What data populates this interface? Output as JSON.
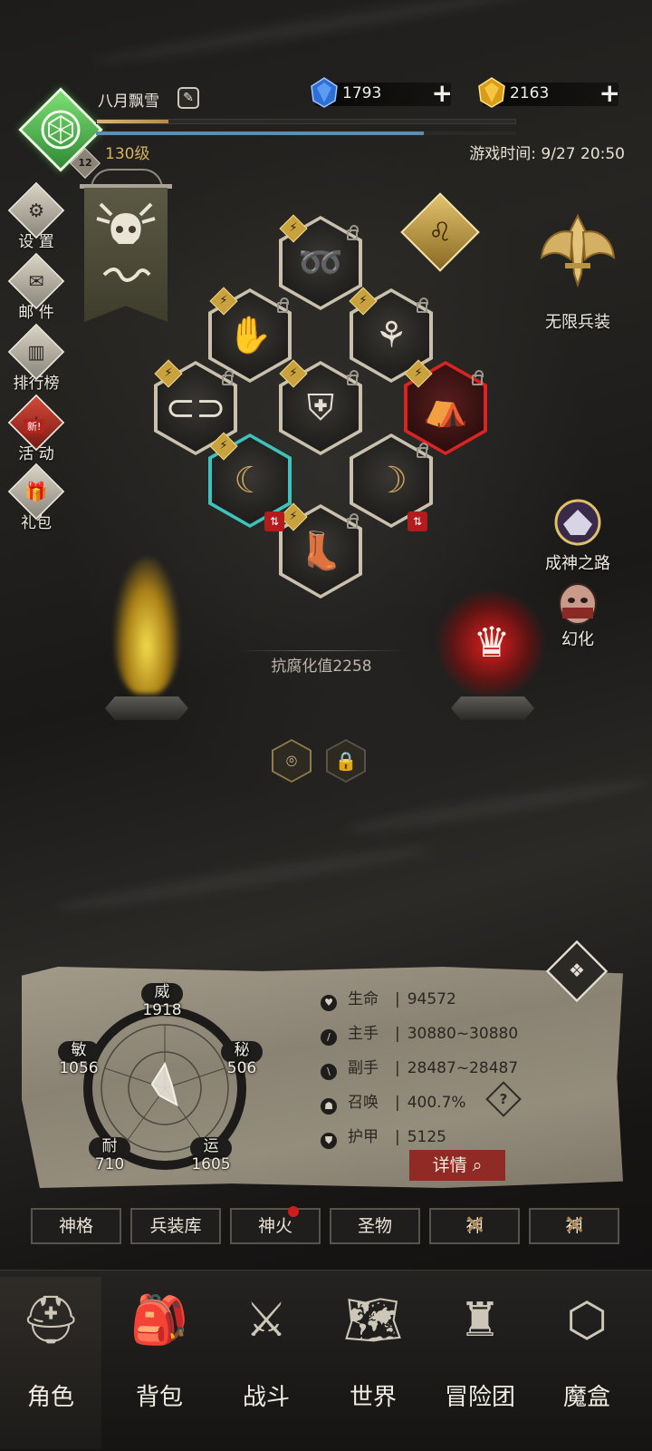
{
  "header": {
    "player_name": "八月飘雪",
    "level": "130级",
    "level_badge": "12",
    "game_time": "游戏时间: 9/27 20:50",
    "xp_progress": 0.17,
    "mp_progress": 0.78,
    "blue_gem": {
      "value": "1793",
      "icon": "blue-crystal-icon"
    },
    "gold_gem": {
      "value": "2163",
      "icon": "gold-crystal-icon"
    }
  },
  "left_menu": [
    {
      "label": "设 置",
      "icon": "gear-icon"
    },
    {
      "label": "邮 件",
      "icon": "mail-icon"
    },
    {
      "label": "排行榜",
      "icon": "ranking-icon"
    },
    {
      "label": "活 动",
      "icon": "event-icon",
      "tag": "新!"
    },
    {
      "label": "礼包",
      "icon": "gift-icon"
    }
  ],
  "right_menu": {
    "infinite_gear": "无限兵装",
    "path_to_godhood": "成神之路",
    "transmog": "幻化"
  },
  "equipment": {
    "corrosion_resistance": "抗腐化值2258",
    "slots": [
      "scarf",
      "left-gauntlet",
      "amulet",
      "belt",
      "chest-armor",
      "cape",
      "left-horn",
      "right-horn",
      "boots"
    ]
  },
  "stats_radar": {
    "wei": {
      "name": "威",
      "value": "1918"
    },
    "mi": {
      "name": "秘",
      "value": "506"
    },
    "yun": {
      "name": "运",
      "value": "1605"
    },
    "nai": {
      "name": "耐",
      "value": "710"
    },
    "min": {
      "name": "敏",
      "value": "1056"
    }
  },
  "attributes": [
    {
      "name": "生命",
      "value": "94572",
      "icon": "heart-icon"
    },
    {
      "name": "主手",
      "value": "30880~30880",
      "icon": "sword-icon"
    },
    {
      "name": "副手",
      "value": "28487~28487",
      "icon": "offhand-icon"
    },
    {
      "name": "召唤",
      "value": "400.7%",
      "icon": "summon-icon"
    },
    {
      "name": "护甲",
      "value": "5125",
      "icon": "armor-icon"
    }
  ],
  "details_button": "详情",
  "sub_tabs": [
    "神格",
    "兵装库",
    "神火",
    "圣物",
    "神",
    "神"
  ],
  "bottom_nav": [
    "角色",
    "背包",
    "战斗",
    "世界",
    "冒险团",
    "魔盒"
  ],
  "colors": {
    "accent_gold": "#d6b35a",
    "danger_red": "#d92424",
    "panel": "#9a9383"
  }
}
